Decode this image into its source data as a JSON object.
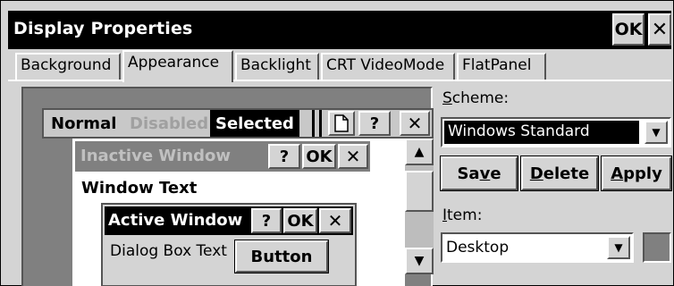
{
  "window": {
    "title": "Display Properties",
    "ok_label": "OK",
    "close_label": "✕"
  },
  "tabs": [
    {
      "label": "Background",
      "active": false
    },
    {
      "label": "Appearance",
      "active": true
    },
    {
      "label": "Backlight",
      "active": false
    },
    {
      "label": "CRT VideoMode",
      "active": false
    },
    {
      "label": "FlatPanel",
      "active": false
    }
  ],
  "preview": {
    "menu": {
      "normal": "Normal",
      "disabled": "Disabled",
      "selected": "Selected"
    },
    "menu_buttons": {
      "help": "?",
      "close": "✕"
    },
    "inactive_window": {
      "title": "Inactive Window",
      "help": "?",
      "ok": "OK",
      "close": "✕"
    },
    "window_text": "Window Text",
    "active_window": {
      "title": "Active Window",
      "help": "?",
      "ok": "OK",
      "close": "✕"
    },
    "dialog_text": "Dialog Box Text",
    "button_label": "Button"
  },
  "scheme": {
    "label": "Scheme:",
    "label_accel": "S",
    "label_rest": "cheme:",
    "value": "Windows Standard"
  },
  "actions": {
    "save_pre": "Sa",
    "save_accel": "v",
    "save_post": "e",
    "delete_accel": "D",
    "delete_rest": "elete",
    "apply_accel": "A",
    "apply_rest": "pply"
  },
  "item": {
    "label_accel": "I",
    "label_rest": "tem:",
    "value": "Desktop"
  },
  "colors": {
    "item_color": "#808080",
    "selection": "#000000"
  }
}
